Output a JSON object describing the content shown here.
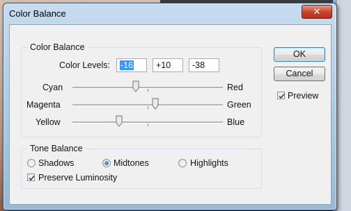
{
  "window": {
    "title": "Color Balance",
    "close_label": "✕"
  },
  "color_balance": {
    "group_title": "Color Balance",
    "levels_label": "Color Levels:",
    "levels": [
      "-16",
      "+10",
      "-38"
    ],
    "sliders": [
      {
        "left": "Cyan",
        "right": "Red",
        "value": -16
      },
      {
        "left": "Magenta",
        "right": "Green",
        "value": 10
      },
      {
        "left": "Yellow",
        "right": "Blue",
        "value": -38
      }
    ]
  },
  "tone_balance": {
    "group_title": "Tone Balance",
    "options": [
      "Shadows",
      "Midtones",
      "Highlights"
    ],
    "selected": "Midtones",
    "preserve_luminosity_label": "Preserve Luminosity",
    "preserve_luminosity_checked": true
  },
  "buttons": {
    "ok": "OK",
    "cancel": "Cancel"
  },
  "preview": {
    "label": "Preview",
    "checked": true
  }
}
